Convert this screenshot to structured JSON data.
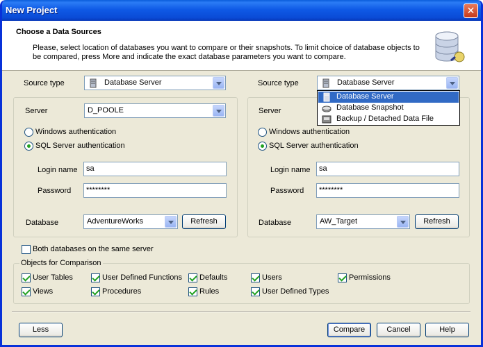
{
  "window": {
    "title": "New Project",
    "close_glyph": "✕"
  },
  "header": {
    "title": "Choose a Data Sources",
    "description": "Please, select location of databases you want to compare or their snapshots. To limit choice of database objects to be compared, press More and indicate the exact database parameters you want to compare.",
    "icon": "database-icon"
  },
  "left": {
    "source_type_label": "Source type",
    "source_type_value": "Database Server",
    "server_label": "Server",
    "server_value": "D_POOLE",
    "windows_auth_label": "Windows authentication",
    "sql_auth_label": "SQL Server authentication",
    "auth_selected": "sql",
    "login_label": "Login name",
    "login_value": "sa",
    "password_label": "Password",
    "password_value": "********",
    "database_label": "Database",
    "database_value": "AdventureWorks",
    "refresh_label": "Refresh"
  },
  "right": {
    "source_type_label": "Source type",
    "source_type_value": "Database Server",
    "server_label": "Server",
    "windows_auth_label": "Windows authentication",
    "sql_auth_label": "SQL Server authentication",
    "auth_selected": "sql",
    "login_label": "Login name",
    "login_value": "sa",
    "password_label": "Password",
    "password_value": "********",
    "database_label": "Database",
    "database_value": "AW_Target",
    "refresh_label": "Refresh"
  },
  "dropdown": {
    "items": [
      {
        "label": "Database Server",
        "icon": "server-icon",
        "selected": true
      },
      {
        "label": "Database Snapshot",
        "icon": "snapshot-icon",
        "selected": false
      },
      {
        "label": "Backup / Detached Data File",
        "icon": "backup-file-icon",
        "selected": false
      }
    ]
  },
  "same_server": {
    "label": "Both databases on the same server",
    "checked": false
  },
  "objects": {
    "legend": "Objects for Comparison",
    "items": [
      {
        "label": "User Tables",
        "checked": true
      },
      {
        "label": "User Defined Functions",
        "checked": true
      },
      {
        "label": "Defaults",
        "checked": true
      },
      {
        "label": "Users",
        "checked": true
      },
      {
        "label": "Permissions",
        "checked": true
      },
      {
        "label": "Views",
        "checked": true
      },
      {
        "label": "Procedures",
        "checked": true
      },
      {
        "label": "Rules",
        "checked": true
      },
      {
        "label": "User Defined Types",
        "checked": true
      }
    ]
  },
  "buttons": {
    "less": "Less",
    "compare": "Compare",
    "cancel": "Cancel",
    "help": "Help"
  }
}
